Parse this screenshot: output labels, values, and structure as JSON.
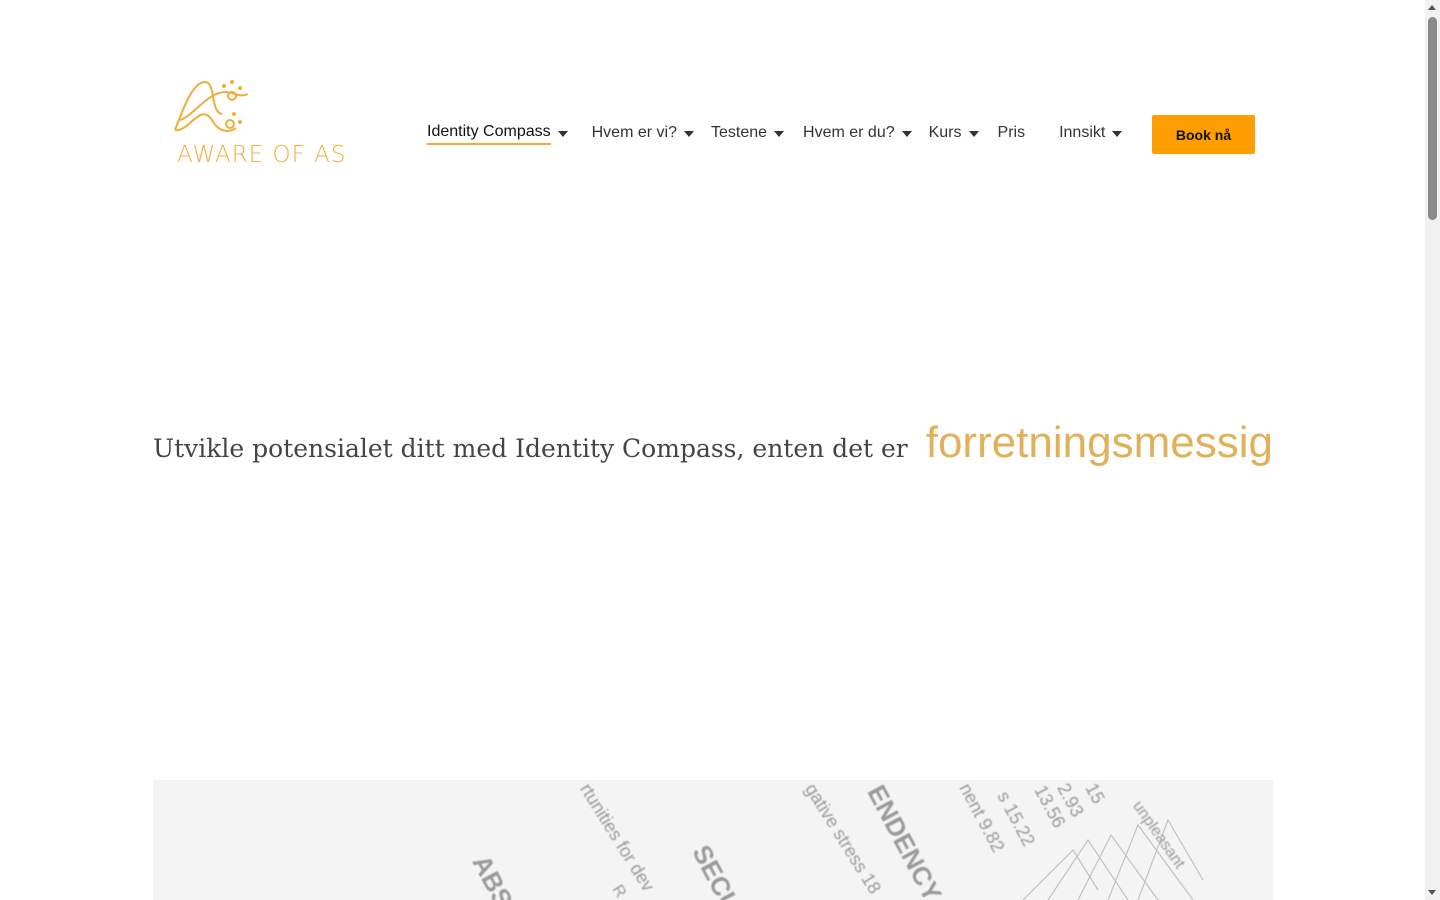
{
  "brand": {
    "logo_text": "AWARE OF AS",
    "accent_color": "#f0ad3c"
  },
  "nav": {
    "items": [
      {
        "label": "Identity Compass",
        "dropdown": true,
        "active": true
      },
      {
        "label": "Hvem er vi?",
        "dropdown": true
      },
      {
        "label": "Testene",
        "dropdown": true
      },
      {
        "label": "Hvem er du?",
        "dropdown": true
      },
      {
        "label": "Kurs",
        "dropdown": true
      },
      {
        "label": "Pris",
        "dropdown": false
      },
      {
        "label": "Innsikt",
        "dropdown": true
      }
    ],
    "cta_label": "Book nå",
    "cta_color": "#ff9e00"
  },
  "hero": {
    "lead": "Utvikle potensialet ditt med Identity Compass, enten det er",
    "rotating_word": "forretningsmessig",
    "rotating_color": "#e0b15a"
  },
  "photo": {
    "snippets": [
      "ABS",
      "rtunities for dev",
      "R",
      "SECU",
      "gative stress 18",
      "ENDENCY",
      "nent 9.82",
      "s 15.22",
      "13.56",
      "2.93",
      "15",
      "unpleasant"
    ]
  }
}
